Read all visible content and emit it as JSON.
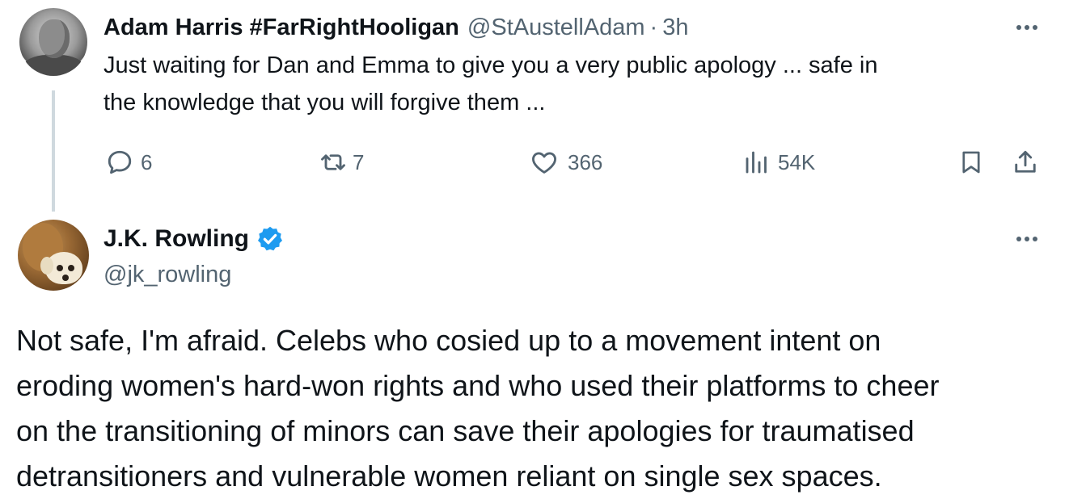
{
  "parent_tweet": {
    "author_name": "Adam Harris #FarRightHooligan",
    "handle": "@StAustellAdam",
    "separator": "·",
    "time": "3h",
    "text_lines": [
      "Just waiting for Dan and Emma to give you a very public apology ... safe in",
      "the knowledge that you will forgive them ..."
    ],
    "actions": {
      "replies": "6",
      "reposts": "7",
      "likes": "366",
      "views": "54K"
    }
  },
  "reply_tweet": {
    "author_name": "J.K. Rowling",
    "handle": "@jk_rowling",
    "verified": true,
    "text_lines": [
      "Not safe, I'm afraid. Celebs who cosied up to a movement intent on",
      "eroding women's hard-won rights and who used their platforms to cheer",
      "on the transitioning of minors can save their apologies for traumatised",
      "detransitioners and vulnerable women reliant on single sex spaces."
    ]
  },
  "colors": {
    "text_primary": "#0f1419",
    "text_secondary": "#536471",
    "verified_blue": "#1d9bf0",
    "thread_line": "#cfd9de"
  },
  "icons": [
    "reply-icon",
    "repost-icon",
    "like-icon",
    "views-icon",
    "bookmark-icon",
    "share-icon",
    "more-icon",
    "verified-badge-icon"
  ]
}
